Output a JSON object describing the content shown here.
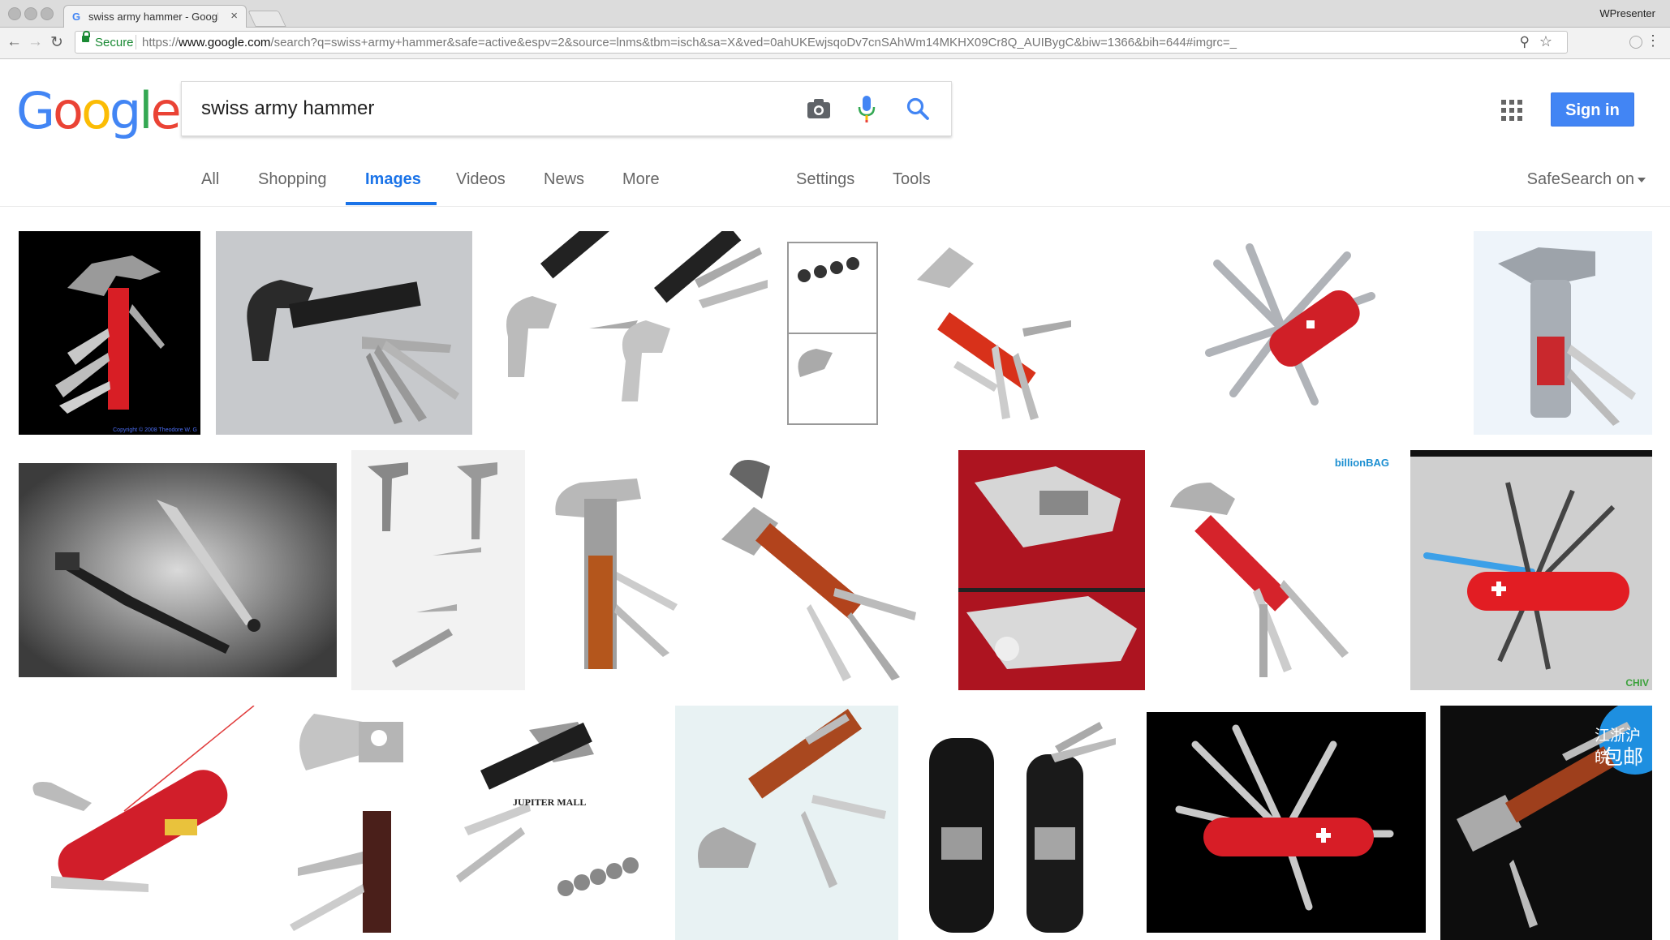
{
  "browser": {
    "tab_title": "swiss army hammer - Google Images",
    "tab_favicon": "G",
    "tab_close": "×",
    "profile_name": "WPresenter",
    "secure_label": "Secure",
    "url_prefix": "https://",
    "url_host": "www.google.com",
    "url_path": "/search?q=swiss+army+hammer&safe=active&espv=2&source=lnms&tbm=isch&sa=X&ved=0ahUKEwjsqoDv7cnSAhWm14MKHX09Cr8Q_AUIBygC&biw=1366&bih=644#imgrc=_",
    "icons": [
      "back-icon",
      "forward-icon",
      "reload-icon",
      "lock-icon",
      "zoom-icon",
      "star-icon",
      "extension-icon",
      "menu-icon"
    ]
  },
  "header": {
    "logo_letters": [
      "G",
      "o",
      "o",
      "g",
      "l",
      "e"
    ],
    "logo_colors": [
      "#4285F4",
      "#EA4335",
      "#FBBC05",
      "#4285F4",
      "#34A853",
      "#EA4335"
    ],
    "search_value": "swiss army hammer",
    "signin_label": "Sign in",
    "icons": [
      "camera-icon",
      "mic-icon",
      "search-icon",
      "apps-icon"
    ]
  },
  "tabs": {
    "items": [
      "All",
      "Shopping",
      "Images",
      "Videos",
      "News",
      "More",
      "Settings",
      "Tools"
    ],
    "active": "Images",
    "safesearch": "SafeSearch on",
    "accent": "#1a73e8"
  },
  "results": {
    "watermarks": [
      "Copyright © 2008 Theodore W. G",
      "billionBAG",
      "JUPITER MALL",
      "江浙沪皖",
      "包邮",
      "CHIV"
    ]
  }
}
